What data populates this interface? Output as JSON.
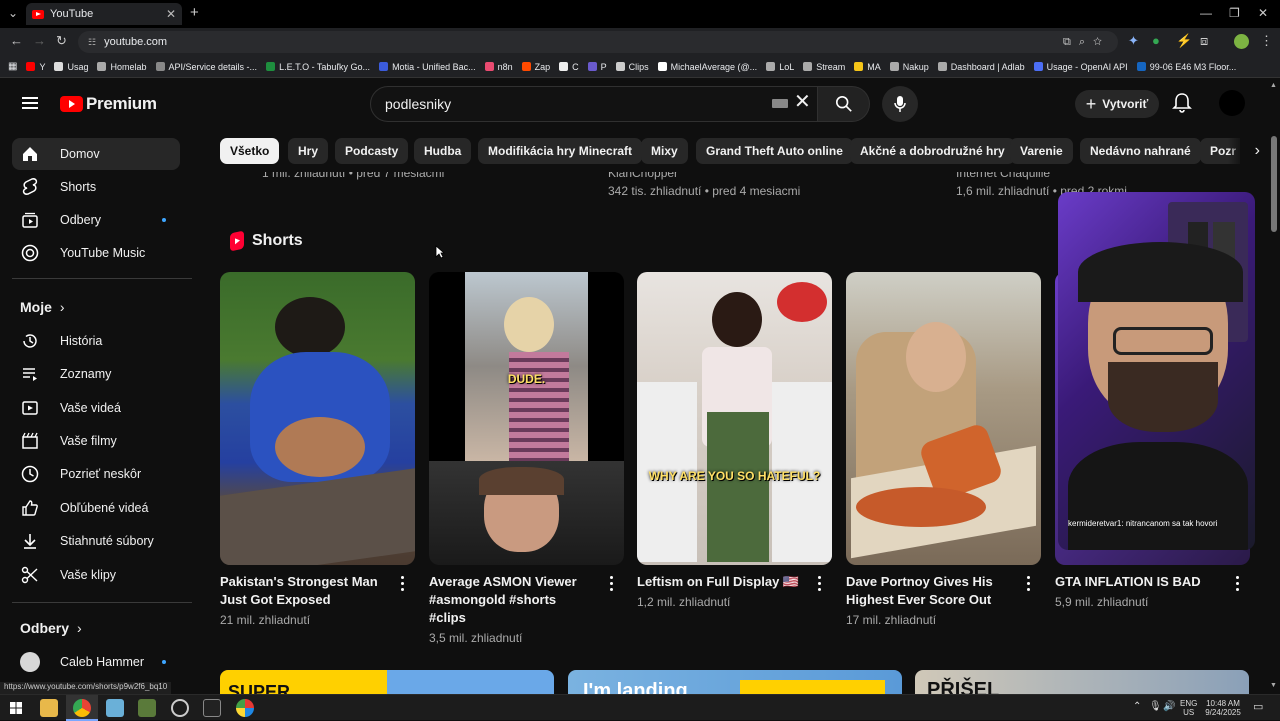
{
  "browser": {
    "tab_title": "YouTube",
    "url": "youtube.com",
    "status_url": "https://www.youtube.com/shorts/p9w2f6_bq10",
    "bookmarks": [
      {
        "label": "Y",
        "color": "#ff0000"
      },
      {
        "label": "Usag",
        "color": "#dddddd"
      },
      {
        "label": "Homelab",
        "color": "#aaaaaa"
      },
      {
        "label": "API/Service details -...",
        "color": "#888888"
      },
      {
        "label": "L.E.T.O - Tabuľky Go...",
        "color": "#1e8e3e"
      },
      {
        "label": "Motia - Unified Bac...",
        "color": "#3b5bdb"
      },
      {
        "label": "n8n",
        "color": "#ea4b71"
      },
      {
        "label": "Zap",
        "color": "#ff4a00"
      },
      {
        "label": "C",
        "color": "#eeeeee"
      },
      {
        "label": "P",
        "color": "#6a5acd"
      },
      {
        "label": "Clips",
        "color": "#cccccc"
      },
      {
        "label": "MichaelAverage (@...",
        "color": "#ffffff"
      },
      {
        "label": "LoL",
        "color": "#aaaaaa"
      },
      {
        "label": "Stream",
        "color": "#aaaaaa"
      },
      {
        "label": "MA",
        "color": "#f5c518"
      },
      {
        "label": "Nakup",
        "color": "#aaaaaa"
      },
      {
        "label": "Dashboard | Adlab",
        "color": "#aaaaaa"
      },
      {
        "label": "Usage - OpenAI API",
        "color": "#4c6ef5"
      },
      {
        "label": "99-06 E46 M3 Floor...",
        "color": "#1565c0"
      }
    ]
  },
  "header": {
    "logo_text": "Premium",
    "search_value": "podlesniky",
    "create_label": "Vytvoriť"
  },
  "sidebar": {
    "main": [
      {
        "label": "Domov",
        "icon": "home-icon",
        "active": true
      },
      {
        "label": "Shorts",
        "icon": "shorts-icon"
      },
      {
        "label": "Odbery",
        "icon": "subscriptions-icon",
        "dot": true
      },
      {
        "label": "YouTube Music",
        "icon": "music-icon"
      }
    ],
    "you_heading": "Moje",
    "you": [
      {
        "label": "História",
        "icon": "history-icon"
      },
      {
        "label": "Zoznamy",
        "icon": "playlists-icon"
      },
      {
        "label": "Vaše videá",
        "icon": "your-videos-icon"
      },
      {
        "label": "Vaše filmy",
        "icon": "movies-icon"
      },
      {
        "label": "Pozrieť neskôr",
        "icon": "watch-later-icon"
      },
      {
        "label": "Obľúbené videá",
        "icon": "like-icon"
      },
      {
        "label": "Stiahnuté súbory",
        "icon": "download-icon"
      },
      {
        "label": "Vaše klipy",
        "icon": "scissors-icon"
      }
    ],
    "subs_heading": "Odbery",
    "subs": [
      {
        "label": "Caleb Hammer",
        "dot": true
      }
    ]
  },
  "chips": [
    "Všetko",
    "Hry",
    "Podcasty",
    "Hudba",
    "Modifikácia hry Minecraft",
    "Mixy",
    "Grand Theft Auto online",
    "Akčné a dobrodružné hry",
    "Varenie",
    "Nedávno nahrané",
    "Pozr"
  ],
  "prev_row": {
    "col1": "1 mil. zhliadnutí • pred 7 mesiacmi",
    "col2_channel": "KlanChopper",
    "col2": "342 tis. zhliadnutí • pred 4 mesiacmi",
    "col3_channel": "Internet Chaquille",
    "col3": "1,6 mil. zhliadnutí • pred 2 rokmi"
  },
  "shorts": {
    "heading": "Shorts",
    "items": [
      {
        "title": "Pakistan's Strongest Man Just Got Exposed",
        "views": "21 mil. zhliadnutí"
      },
      {
        "title": "Average ASMON Viewer #asmongold #shorts #clips",
        "views": "3,5 mil. zhliadnutí",
        "caption": "DUDE."
      },
      {
        "title": "Leftism on Full Display 🇺🇸",
        "views": "1,2 mil. zhliadnutí",
        "caption": "WHY ARE YOU SO HATEFUL?"
      },
      {
        "title": "Dave Portnoy Gives His Highest Ever Score Out",
        "views": "17 mil. zhliadnutí"
      },
      {
        "title": "GTA INFLATION IS BAD",
        "views": "5,9 mil. zhliadnutí"
      }
    ]
  },
  "pip": {
    "chat_user": "kermideretvar1:",
    "chat_text": "nitrancanom sa tak hovori"
  },
  "taskbar": {
    "lang": "ENG",
    "region": "US",
    "time": "10:48 AM",
    "date": "9/24/2025"
  }
}
